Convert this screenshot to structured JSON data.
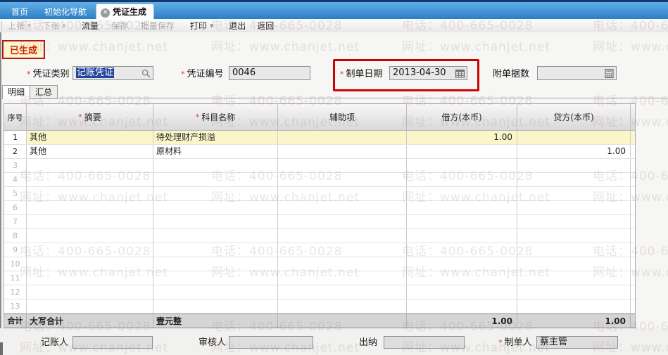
{
  "required_marker": "*",
  "window_tabs": {
    "items": [
      {
        "label": "首页",
        "active": false
      },
      {
        "label": "初始化导航",
        "active": false
      },
      {
        "label": "凭证生成",
        "active": true,
        "closable": true
      }
    ]
  },
  "toolbar": {
    "buttons": [
      {
        "label": "上张",
        "arrow": true,
        "disabled": true
      },
      {
        "label": "下张",
        "arrow": true,
        "disabled": true
      },
      {
        "label": "流量",
        "arrow": false,
        "disabled": false
      },
      {
        "label": "保存",
        "arrow": false,
        "disabled": true
      },
      {
        "label": "批量保存",
        "arrow": false,
        "disabled": true
      },
      {
        "label": "打印",
        "arrow": true,
        "disabled": false
      },
      {
        "label": "退出",
        "arrow": false,
        "disabled": false
      },
      {
        "label": "返回",
        "arrow": false,
        "disabled": false
      }
    ]
  },
  "status_badge": "已生成",
  "form": {
    "voucher_type": {
      "label": "凭证类别",
      "required": true,
      "value": "记账凭证",
      "icon": "magnifier-icon"
    },
    "voucher_no": {
      "label": "凭证编号",
      "required": true,
      "value": "0046"
    },
    "doc_date": {
      "label": "制单日期",
      "required": true,
      "value": "2013-04-30",
      "icon": "calendar-icon",
      "annotated_with_red_box": true
    },
    "attachments": {
      "label": "附单据数",
      "required": false,
      "value": "",
      "icon": "calculator-icon"
    }
  },
  "subtabs": [
    {
      "label": "明细",
      "active": true
    },
    {
      "label": "汇总",
      "active": false
    }
  ],
  "table": {
    "headers": [
      {
        "label": "序号",
        "required": false
      },
      {
        "label": "摘要",
        "required": true
      },
      {
        "label": "科目名称",
        "required": true
      },
      {
        "label": "辅助项",
        "required": false
      },
      {
        "label": "借方(本币)",
        "required": false
      },
      {
        "label": "贷方(本币)",
        "required": false
      }
    ],
    "rows": [
      {
        "no": "1",
        "summary": "其他",
        "account": "待处理财产损溢",
        "aux": "",
        "debit": "1.00",
        "credit": "",
        "highlight": true
      },
      {
        "no": "2",
        "summary": "其他",
        "account": "原材料",
        "aux": "",
        "debit": "",
        "credit": "1.00",
        "highlight": false
      },
      {
        "no": "3",
        "summary": "",
        "account": "",
        "aux": "",
        "debit": "",
        "credit": "",
        "highlight": false
      },
      {
        "no": "4",
        "summary": "",
        "account": "",
        "aux": "",
        "debit": "",
        "credit": "",
        "highlight": false
      },
      {
        "no": "5",
        "summary": "",
        "account": "",
        "aux": "",
        "debit": "",
        "credit": "",
        "highlight": false
      },
      {
        "no": "6",
        "summary": "",
        "account": "",
        "aux": "",
        "debit": "",
        "credit": "",
        "highlight": false
      },
      {
        "no": "7",
        "summary": "",
        "account": "",
        "aux": "",
        "debit": "",
        "credit": "",
        "highlight": false
      },
      {
        "no": "8",
        "summary": "",
        "account": "",
        "aux": "",
        "debit": "",
        "credit": "",
        "highlight": false
      },
      {
        "no": "9",
        "summary": "",
        "account": "",
        "aux": "",
        "debit": "",
        "credit": "",
        "highlight": false
      },
      {
        "no": "10",
        "summary": "",
        "account": "",
        "aux": "",
        "debit": "",
        "credit": "",
        "highlight": false
      },
      {
        "no": "11",
        "summary": "",
        "account": "",
        "aux": "",
        "debit": "",
        "credit": "",
        "highlight": false
      },
      {
        "no": "12",
        "summary": "",
        "account": "",
        "aux": "",
        "debit": "",
        "credit": "",
        "highlight": false
      },
      {
        "no": "13",
        "summary": "",
        "account": "",
        "aux": "",
        "debit": "",
        "credit": "",
        "highlight": false
      }
    ],
    "total": {
      "label": "合计",
      "caps_label": "大写合计",
      "caps_value": "壹元整",
      "debit": "1.00",
      "credit": "1.00"
    }
  },
  "footer": {
    "bookkeeper": {
      "label": "记账人",
      "required": false,
      "value": ""
    },
    "reviewer": {
      "label": "审核人",
      "required": false,
      "value": ""
    },
    "cashier": {
      "label": "出纳",
      "required": false,
      "value": ""
    },
    "preparer": {
      "label": "制单人",
      "required": true,
      "value": "蔡主管"
    }
  },
  "watermark": {
    "phone": "电话：400-665-0028",
    "url": "网址：www.chanjet.net"
  },
  "colors": {
    "annotation_red": "#cc0202",
    "badge_red": "#cf2200",
    "selection_blue": "#24459c",
    "tabbar_blue": "#2e7ec4",
    "highlight_row_yellow": "#fbf6ca"
  }
}
